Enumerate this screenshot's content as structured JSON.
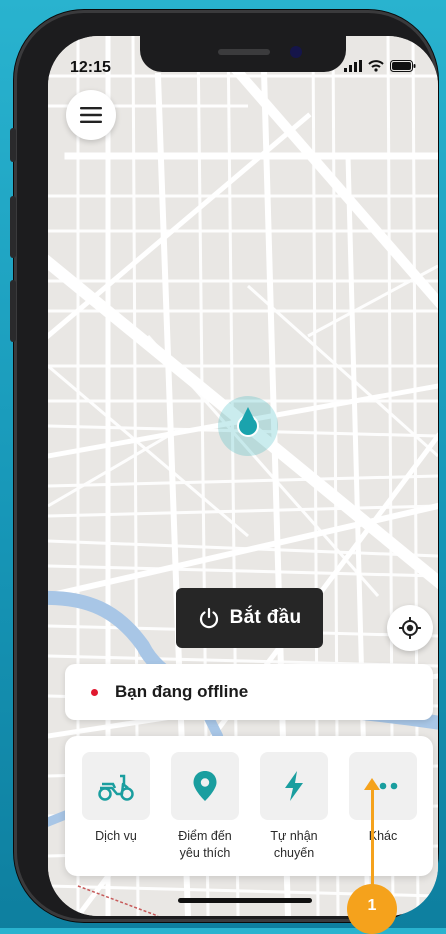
{
  "status_bar": {
    "time": "12:15"
  },
  "map": {
    "start_button_label": "Bắt đầu"
  },
  "status_card": {
    "text": "Bạn đang offline",
    "dot_color": "#e0182f"
  },
  "quick_actions": [
    {
      "label": "Dịch vụ",
      "icon": "scooter-icon"
    },
    {
      "label": "Điểm đến\nyêu thích",
      "icon": "location-pin-icon"
    },
    {
      "label": "Tự nhận\nchuyến",
      "icon": "lightning-icon"
    },
    {
      "label": "Khác",
      "icon": "more-dots-icon"
    }
  ],
  "annotation": {
    "badge": "1",
    "color": "#f5a21c"
  },
  "colors": {
    "accent": "#1a9e9f",
    "button_dark": "#262626"
  }
}
